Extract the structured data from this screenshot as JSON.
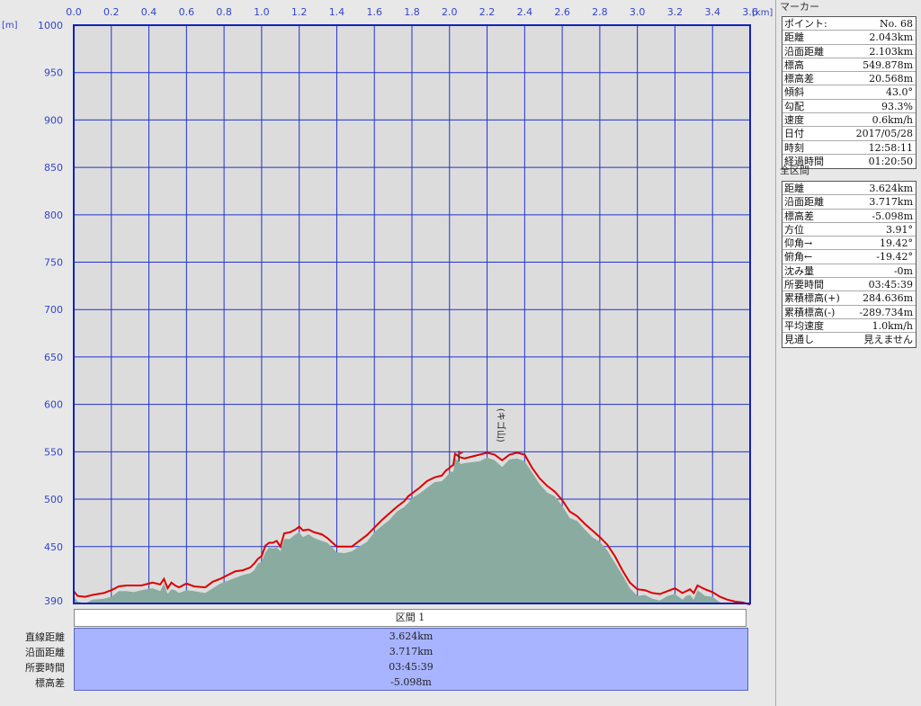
{
  "chart_data": {
    "type": "area",
    "xunit": "[km]",
    "yunit": "[m]",
    "xlim": [
      0,
      3.6
    ],
    "ylim": [
      390,
      1000
    ],
    "xticks": [
      "0.0",
      "0.2",
      "0.4",
      "0.6",
      "0.8",
      "1.0",
      "1.2",
      "1.4",
      "1.6",
      "1.8",
      "2.0",
      "2.2",
      "2.4",
      "2.6",
      "2.8",
      "3.0",
      "3.2",
      "3.4",
      "3.6"
    ],
    "yticks": [
      "1000",
      "950",
      "900",
      "850",
      "800",
      "750",
      "700",
      "650",
      "600",
      "550",
      "500",
      "450",
      "390"
    ],
    "grid": true,
    "peak_label": "(キゴ山)",
    "peak_x": 2.05,
    "series": [
      {
        "x": [
          0.0,
          0.02,
          0.06,
          0.1,
          0.16,
          0.2,
          0.24,
          0.28,
          0.32,
          0.36,
          0.42,
          0.46,
          0.48,
          0.5,
          0.52,
          0.54,
          0.56,
          0.6,
          0.64,
          0.7,
          0.74,
          0.78,
          0.82,
          0.86,
          0.9,
          0.94,
          0.96,
          0.98,
          1.0,
          1.02,
          1.04,
          1.06,
          1.08,
          1.1,
          1.12,
          1.15,
          1.18,
          1.2,
          1.22,
          1.25,
          1.28,
          1.32,
          1.35,
          1.4,
          1.44,
          1.48,
          1.52,
          1.56,
          1.6,
          1.64,
          1.68,
          1.72,
          1.76,
          1.78,
          1.8,
          1.84,
          1.88,
          1.92,
          1.96,
          1.98,
          2.0,
          2.01,
          2.02,
          2.03,
          2.05,
          2.06,
          2.08,
          2.12,
          2.16,
          2.2,
          2.24,
          2.28,
          2.32,
          2.36,
          2.4,
          2.44,
          2.48,
          2.52,
          2.56,
          2.6,
          2.64,
          2.68,
          2.72,
          2.76,
          2.8,
          2.84,
          2.88,
          2.92,
          2.96,
          3.0,
          3.04,
          3.08,
          3.12,
          3.16,
          3.2,
          3.24,
          3.26,
          3.28,
          3.3,
          3.32,
          3.34,
          3.36,
          3.4,
          3.44,
          3.48,
          3.52,
          3.56,
          3.6
        ],
        "y": [
          403,
          398,
          397,
          399,
          401,
          404,
          408,
          409,
          409,
          409,
          412,
          410,
          416,
          406,
          412,
          409,
          407,
          411,
          408,
          407,
          413,
          416,
          420,
          424,
          425,
          428,
          432,
          437,
          440,
          451,
          454,
          454,
          456,
          450,
          464,
          465,
          468,
          471,
          467,
          468,
          465,
          463,
          459,
          450,
          450,
          450,
          456,
          462,
          470,
          478,
          485,
          492,
          498,
          503,
          506,
          512,
          519,
          523,
          525,
          530,
          533,
          535,
          536,
          548,
          545,
          544,
          543,
          545,
          547,
          549,
          547,
          541,
          547,
          549,
          547,
          533,
          522,
          514,
          508,
          499,
          487,
          482,
          474,
          467,
          460,
          452,
          440,
          425,
          412,
          405,
          404,
          401,
          400,
          403,
          406,
          401,
          403,
          405,
          401,
          409,
          407,
          405,
          402,
          397,
          394,
          392,
          391,
          389
        ]
      }
    ]
  },
  "marker": {
    "title": "マーカー",
    "rows": [
      {
        "k": "ポイント:",
        "v": "No. 68"
      },
      {
        "k": "距離",
        "v": "2.043km"
      },
      {
        "k": "沿面距離",
        "v": "2.103km"
      },
      {
        "k": "標高",
        "v": "549.878m"
      },
      {
        "k": "標高差",
        "v": "20.568m"
      },
      {
        "k": "傾斜",
        "v": "43.0°"
      },
      {
        "k": "勾配",
        "v": "93.3%"
      },
      {
        "k": "速度",
        "v": "0.6km/h"
      },
      {
        "k": "日付",
        "v": "2017/05/28"
      },
      {
        "k": "時刻",
        "v": "12:58:11"
      },
      {
        "k": "経過時間",
        "v": "01:20:50"
      }
    ]
  },
  "whole": {
    "title": "全区間",
    "rows": [
      {
        "k": "距離",
        "v": "3.624km"
      },
      {
        "k": "沿面距離",
        "v": "3.717km"
      },
      {
        "k": "標高差",
        "v": "-5.098m"
      },
      {
        "k": "方位",
        "v": "3.91°"
      },
      {
        "k": "仰角→",
        "v": "19.42°"
      },
      {
        "k": "俯角←",
        "v": "-19.42°"
      },
      {
        "k": "沈み量",
        "v": "-0m"
      },
      {
        "k": "所要時間",
        "v": "03:45:39"
      },
      {
        "k": "累積標高(+)",
        "v": "284.636m"
      },
      {
        "k": "累積標高(-)",
        "v": "-289.734m"
      },
      {
        "k": "平均速度",
        "v": "1.0km/h"
      },
      {
        "k": "見通し",
        "v": "見えません"
      }
    ]
  },
  "section": {
    "header": "区間 1",
    "labels": [
      "直線距離",
      "沿面距離",
      "所要時間",
      "標高差"
    ],
    "values": [
      "3.624km",
      "3.717km",
      "03:45:39",
      "-5.098m"
    ]
  },
  "colors": {
    "plot_bg": "#dcdcdc",
    "grid": "#2233cc",
    "profile_line": "#dd0000",
    "terrain_fill": "#8aaba0",
    "section_bg": "#a8b4ff"
  }
}
